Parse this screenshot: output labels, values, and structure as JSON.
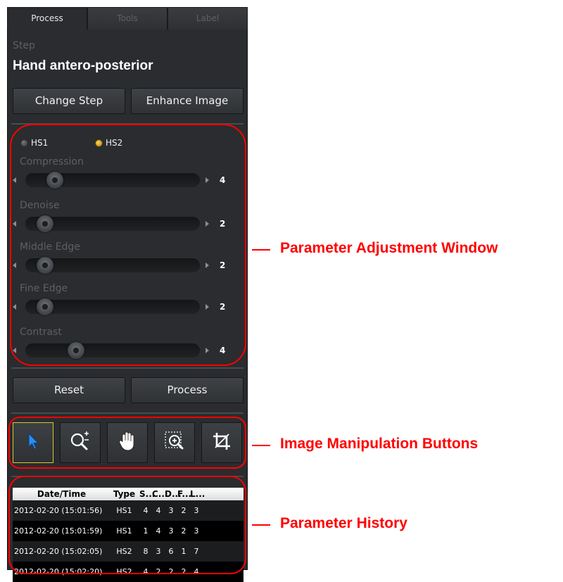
{
  "tabs": [
    {
      "label": "Process",
      "active": true
    },
    {
      "label": "Tools",
      "active": false
    },
    {
      "label": "Label",
      "active": false
    }
  ],
  "step": {
    "caption": "Step",
    "title": "Hand antero-posterior"
  },
  "buttons": {
    "change_step": "Change Step",
    "enhance_image": "Enhance Image",
    "reset": "Reset",
    "process": "Process"
  },
  "radios": [
    {
      "label": "HS1",
      "selected": false
    },
    {
      "label": "HS2",
      "selected": true
    }
  ],
  "parameters": [
    {
      "label": "Compression",
      "value": "4"
    },
    {
      "label": "Denoise",
      "value": "2"
    },
    {
      "label": "Middle Edge",
      "value": "2"
    },
    {
      "label": "Fine Edge",
      "value": "2"
    },
    {
      "label": "Contrast",
      "value": "4"
    }
  ],
  "tools": [
    {
      "icon": "pointer-arrow-icon",
      "selected": true
    },
    {
      "icon": "zoom-in-out-icon",
      "selected": false
    },
    {
      "icon": "pan-hand-icon",
      "selected": false
    },
    {
      "icon": "zoom-region-icon",
      "selected": false
    },
    {
      "icon": "crop-icon",
      "selected": false
    }
  ],
  "history": {
    "columns": [
      "Date/Time",
      "Type",
      "S...",
      "C...",
      "D...",
      "F...",
      "L..."
    ],
    "rows": [
      [
        "2012-02-20 (15:01:56)",
        "HS1",
        "4",
        "4",
        "3",
        "2",
        "3"
      ],
      [
        "2012-02-20 (15:01:59)",
        "HS1",
        "1",
        "4",
        "3",
        "2",
        "3"
      ],
      [
        "2012-02-20 (15:02:05)",
        "HS2",
        "8",
        "3",
        "6",
        "1",
        "7"
      ],
      [
        "2012-02-20 (15:02:20)",
        "HS2",
        "4",
        "2",
        "2",
        "2",
        "4"
      ]
    ]
  },
  "annotations": {
    "parameter_window": "Parameter Adjustment Window",
    "manipulation_buttons": "Image Manipulation Buttons",
    "parameter_history": "Parameter History"
  },
  "colors": {
    "annotation": "#ff0000",
    "selected_tool": "#d6c92a",
    "panel": "#2a2c2f"
  }
}
